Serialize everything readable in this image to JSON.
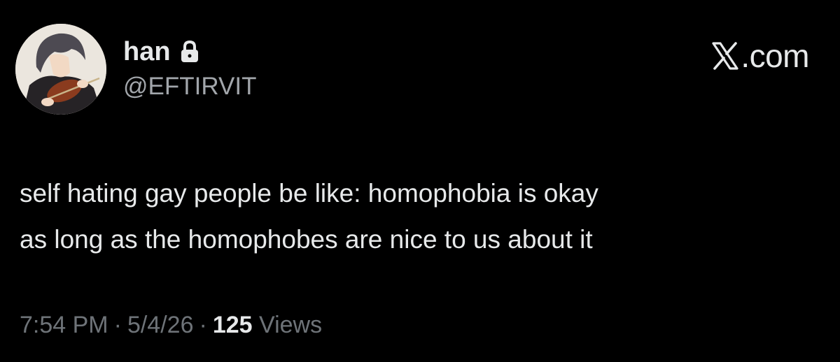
{
  "author": {
    "display_name": "han",
    "handle": "@EFTIRVIT",
    "avatar_icon": "avatar-anime-violinist",
    "protected_icon": "lock-icon"
  },
  "brand": {
    "logo_icon": "x-logo-icon",
    "text": ".com"
  },
  "tweet": {
    "lines": [
      "self hating gay people be like: homophobia is okay",
      "as long as the homophobes are nice to us about it"
    ]
  },
  "meta": {
    "time": "7:54 PM",
    "separator": "·",
    "date": "5/4/26",
    "views_count": "125",
    "views_label": "Views"
  },
  "colors": {
    "background": "#000000",
    "primary_text": "#e7e9ea",
    "secondary_text": "#a2a6ab",
    "meta_text": "#6e7378"
  }
}
